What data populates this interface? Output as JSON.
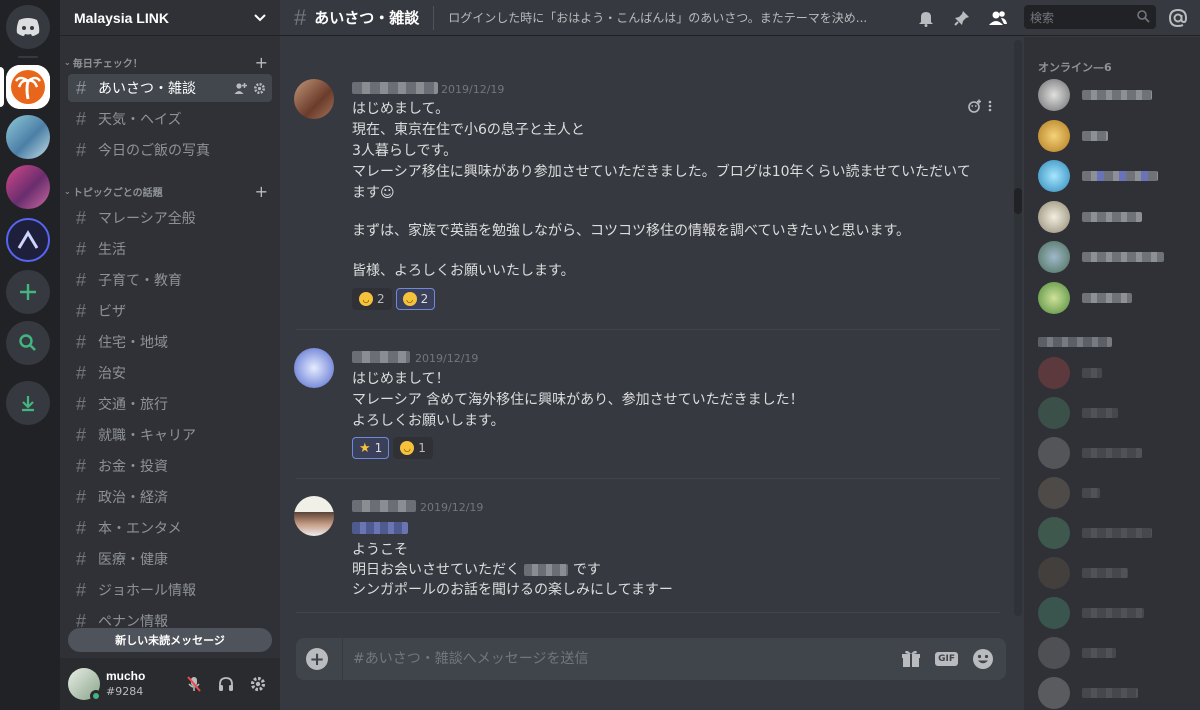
{
  "server_rail": {
    "servers": [
      "discord-home",
      "malaysia-link",
      "server-2",
      "server-3",
      "server-4"
    ],
    "accent": "#43b581"
  },
  "guild": {
    "name": "Malaysia LINK"
  },
  "categories": [
    {
      "name": "毎日チェック！",
      "channels": [
        "あいさつ・雑談",
        "天気・ヘイズ",
        "今日のご飯の写真"
      ]
    },
    {
      "name": "トピックごとの話題",
      "channels": [
        "マレーシア全般",
        "生活",
        "子育て・教育",
        "ビザ",
        "住宅・地域",
        "治安",
        "交通・旅行",
        "就職・キャリア",
        "お金・投資",
        "政治・経済",
        "本・エンタメ",
        "医療・健康",
        "ジョホール情報",
        "ペナン情報"
      ]
    }
  ],
  "active_channel": "あいさつ・雑談",
  "new_unread_label": "新しい未読メッセージ",
  "user": {
    "name": "mucho",
    "tag": "#9284",
    "status_color": "#43b581"
  },
  "topbar": {
    "hash": "#",
    "channel": "あいさつ・雑談",
    "topic": "ログインした時に「おはよう・こんばんは」のあいさつ。またテーマを決め...",
    "search_placeholder": "検索"
  },
  "messages": [
    {
      "timestamp": "2019/12/19",
      "lines": [
        "はじめまして。",
        "現在、東京在住で小6の息子と主人と",
        "3人暮らしです。",
        "マレーシア移住に興味があり参加させていただきました。ブログは10年くらい読ませていただいて",
        "ます☺",
        "",
        "まずは、家族で英語を勉強しながら、コツコツ移住の情報を調べていきたいと思います。",
        "",
        "皆様、よろしくお願いいたします。"
      ],
      "reactions": [
        {
          "emoji": "grinning",
          "count": "2",
          "me": false
        },
        {
          "emoji": "laughing",
          "count": "2",
          "me": true
        }
      ]
    },
    {
      "timestamp": "2019/12/19",
      "lines": [
        "はじめまして！",
        "マレーシア 含めて海外移住に興味があり、参加させていただきました！",
        "よろしくお願いします。"
      ],
      "reactions": [
        {
          "emoji": "star",
          "count": "1",
          "me": true
        },
        {
          "emoji": "laughing",
          "count": "1",
          "me": false
        }
      ]
    },
    {
      "timestamp": "2019/12/19",
      "lines": [
        "ようこそ",
        "明日お会いさせていただく",
        "です",
        "シンガポールのお話を聞けるの楽しみにしてますー"
      ]
    }
  ],
  "composer": {
    "placeholder": "#あいさつ・雑談へメッセージを送信",
    "gif_label": "GIF"
  },
  "members": {
    "online_header": "オンライン—6"
  }
}
